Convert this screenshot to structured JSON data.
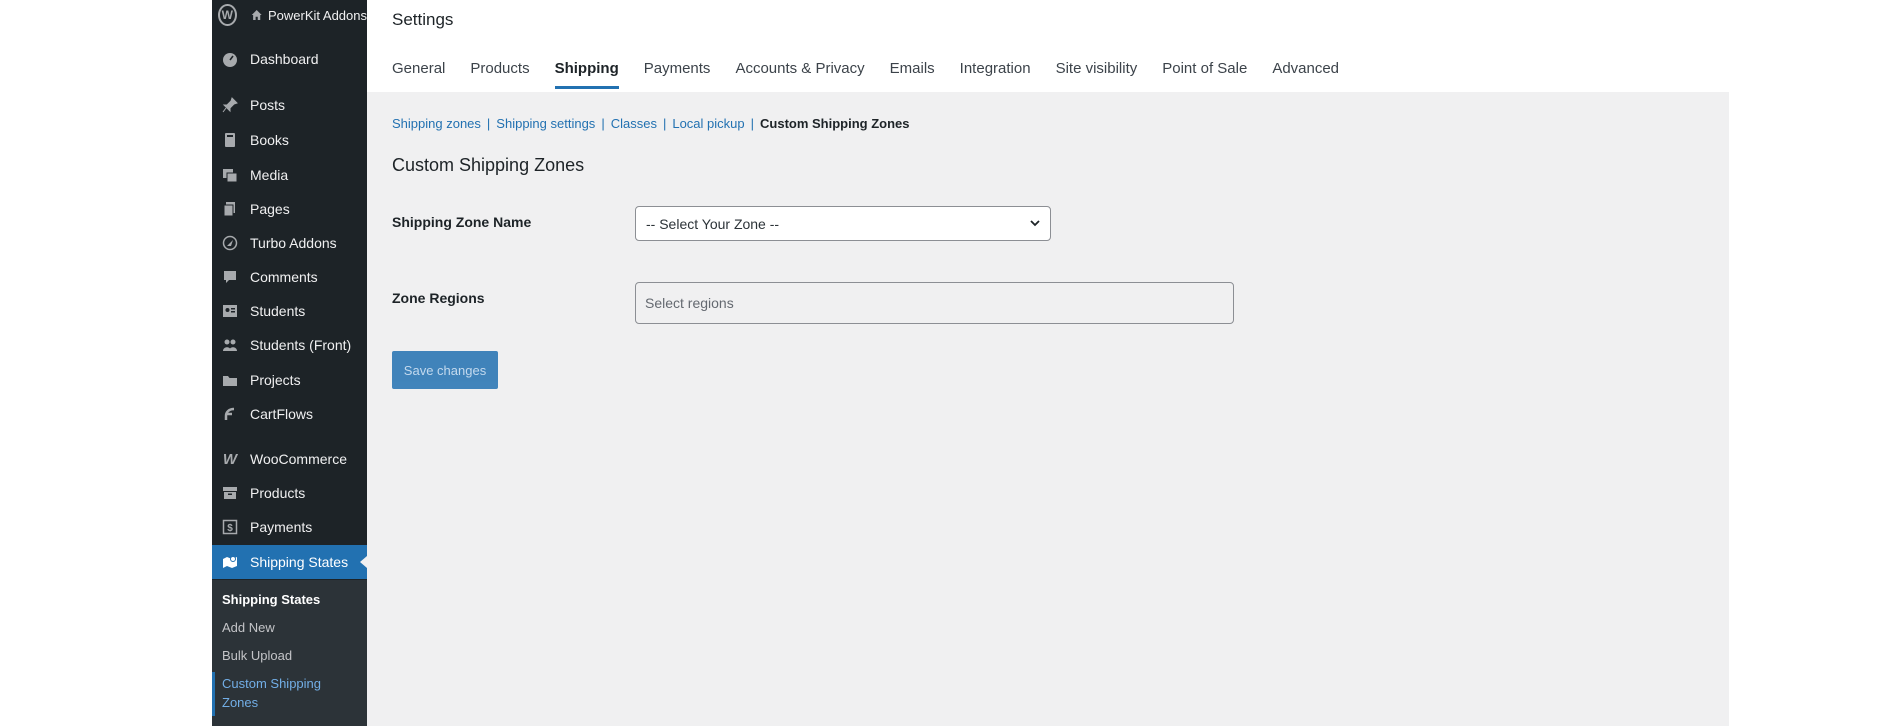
{
  "adminbar": {
    "site_name": "PowerKit Addons"
  },
  "sidebar": {
    "items": [
      {
        "label": "Dashboard",
        "icon": "dashboard-icon"
      },
      {
        "label": "Posts",
        "icon": "pin-icon"
      },
      {
        "label": "Books",
        "icon": "book-icon"
      },
      {
        "label": "Media",
        "icon": "media-icon"
      },
      {
        "label": "Pages",
        "icon": "pages-icon"
      },
      {
        "label": "Turbo Addons",
        "icon": "rocket-icon"
      },
      {
        "label": "Comments",
        "icon": "comment-icon"
      },
      {
        "label": "Students",
        "icon": "id-card-icon"
      },
      {
        "label": "Students (Front)",
        "icon": "group-icon"
      },
      {
        "label": "Projects",
        "icon": "folder-icon"
      },
      {
        "label": "CartFlows",
        "icon": "cartflows-icon"
      },
      {
        "label": "WooCommerce",
        "icon": "woo-icon"
      },
      {
        "label": "Products",
        "icon": "archive-icon"
      },
      {
        "label": "Payments",
        "icon": "dollar-icon"
      },
      {
        "label": "Shipping States",
        "icon": "map-icon"
      }
    ],
    "submenu": [
      "Shipping States",
      "Add New",
      "Bulk Upload",
      "Custom Shipping",
      "Zones"
    ]
  },
  "page": {
    "title": "Settings"
  },
  "tabs": [
    "General",
    "Products",
    "Shipping",
    "Payments",
    "Accounts & Privacy",
    "Emails",
    "Integration",
    "Site visibility",
    "Point of Sale",
    "Advanced"
  ],
  "subnav": {
    "links": [
      "Shipping zones",
      "Shipping settings",
      "Classes",
      "Local pickup"
    ],
    "separator": "|",
    "current": "Custom Shipping Zones"
  },
  "form": {
    "section_title": "Custom Shipping Zones",
    "zone_label": "Shipping Zone Name",
    "zone_value": "-- Select Your Zone --",
    "regions_label": "Zone Regions",
    "regions_placeholder": "Select regions",
    "save_label": "Save changes"
  },
  "colors": {
    "accent": "#2271b1",
    "sidebar_bg": "#1d2327",
    "content_bg": "#f0f0f1"
  }
}
